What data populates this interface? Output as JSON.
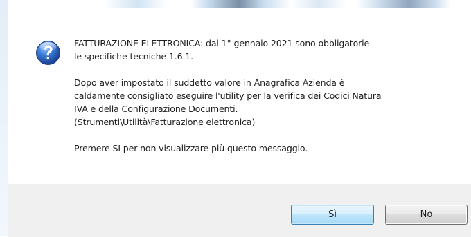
{
  "dialog": {
    "icon": "question-icon",
    "message_lines": [
      "FATTURAZIONE ELETTRONICA: dal 1° gennaio 2021 sono obbligatorie",
      "le specifiche tecniche 1.6.1.",
      "",
      "Dopo aver impostato il suddetto valore in Anagrafica Azienda è",
      "caldamente consigliato eseguire l'utility per la verifica dei Codici Natura",
      "IVA e della Configurazione Documenti.",
      "(Strumenti\\Utilità\\Fatturazione elettronica)",
      "",
      "Premere SI per non visualizzare più questo messaggio."
    ]
  },
  "buttons": {
    "yes_label": "Sì",
    "no_label": "No"
  },
  "colors": {
    "icon_blue": "#2a63c4",
    "default_button_border": "#3c7fb1",
    "footer_background": "#f0f0f0"
  }
}
